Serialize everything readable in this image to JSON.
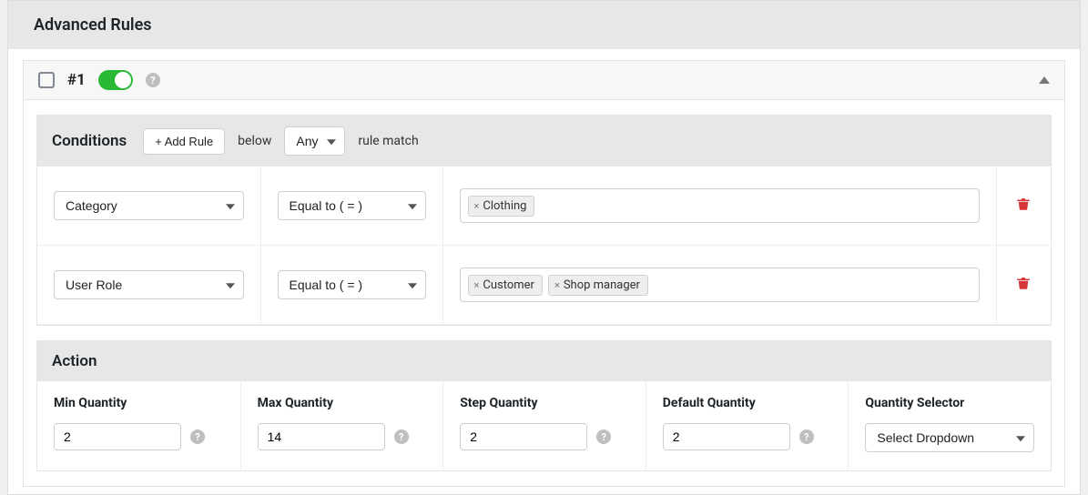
{
  "header": {
    "title": "Advanced Rules"
  },
  "rule": {
    "number": "#1",
    "conditions": {
      "title": "Conditions",
      "add_button": "+ Add Rule",
      "below": "below",
      "match_selector": "Any",
      "rule_match": "rule match",
      "rows": [
        {
          "field": "Category",
          "operator": "Equal to ( = )",
          "tags": [
            "Clothing"
          ]
        },
        {
          "field": "User Role",
          "operator": "Equal to ( = )",
          "tags": [
            "Customer",
            "Shop manager"
          ]
        }
      ]
    },
    "action": {
      "title": "Action",
      "min_label": "Min Quantity",
      "min_value": "2",
      "max_label": "Max Quantity",
      "max_value": "14",
      "step_label": "Step Quantity",
      "step_value": "2",
      "default_label": "Default Quantity",
      "default_value": "2",
      "selector_label": "Quantity Selector",
      "selector_value": "Select Dropdown"
    }
  }
}
